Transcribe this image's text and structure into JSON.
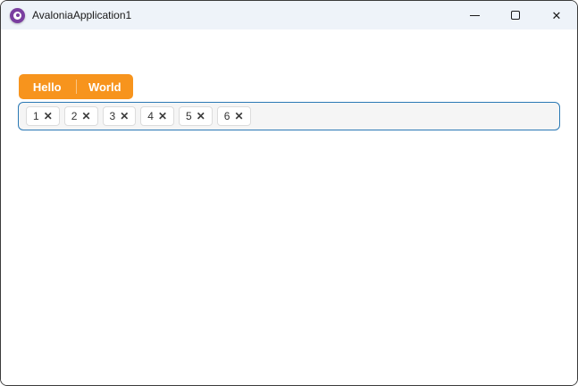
{
  "window": {
    "title": "AvaloniaApplication1",
    "controls": {
      "close_glyph": "✕"
    }
  },
  "tabs": [
    {
      "label": "Hello"
    },
    {
      "label": "World"
    }
  ],
  "chips": {
    "close_glyph": "✕",
    "items": [
      {
        "label": "1"
      },
      {
        "label": "2"
      },
      {
        "label": "3"
      },
      {
        "label": "4"
      },
      {
        "label": "5"
      },
      {
        "label": "6"
      }
    ]
  },
  "colors": {
    "accent_orange": "#f7941d",
    "focus_blue": "#2b79b5",
    "titlebar_bg": "#eef3f9",
    "window_border": "#3b3b3b",
    "logo_purple": "#7b3fa0"
  }
}
